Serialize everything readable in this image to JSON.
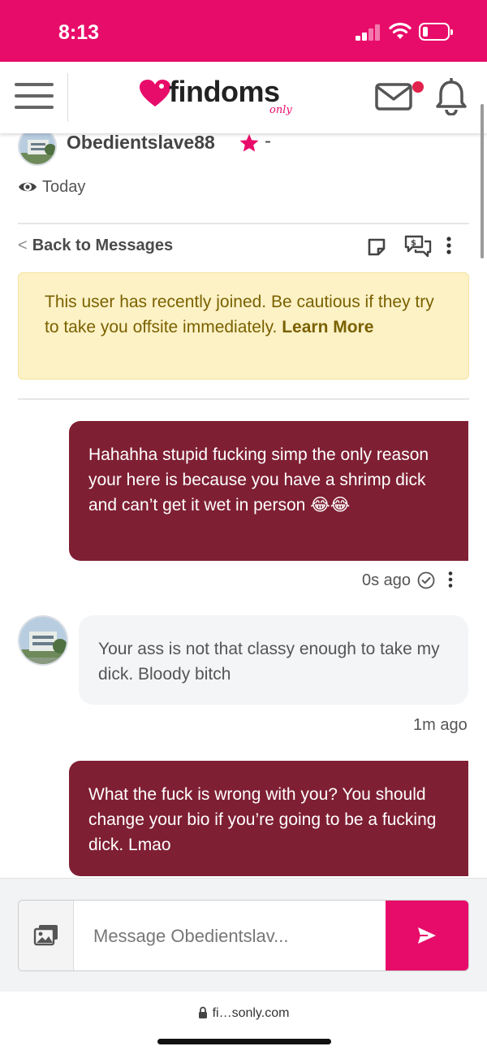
{
  "status_bar": {
    "time": "8:13"
  },
  "header": {
    "logo_text": "findoms",
    "logo_sub": "only",
    "menu_icon": "hamburger-menu-icon",
    "mail_icon": "envelope-icon",
    "bell_icon": "bell-icon"
  },
  "profile": {
    "username": "Obedientslave88",
    "suffix": "-",
    "seen": "Today"
  },
  "toolbar": {
    "back_label": "Back to Messages"
  },
  "warning": {
    "text": "This user has recently joined. Be cautious if they try to take you offsite immediately.",
    "link": "Learn More"
  },
  "messages": [
    {
      "direction": "out",
      "text": "Hahahha stupid fucking simp the only reason your here is because you have a shrimp dick and can’t get it wet in person 😂😂",
      "time": "0s ago"
    },
    {
      "direction": "in",
      "text": "Your ass is not that classy enough to take my dick. Bloody bitch",
      "time": "1m ago"
    },
    {
      "direction": "out",
      "text": "What the fuck is wrong with you? You should change your bio if you’re going to be a fucking dick. Lmao"
    }
  ],
  "composer": {
    "placeholder": "Message Obedientslav..."
  },
  "browser": {
    "url": "fi…sonly.com"
  },
  "colors": {
    "brand": "#e80c6a",
    "bubble_out": "#7f1f33",
    "warning_bg": "#fdf2c6"
  }
}
